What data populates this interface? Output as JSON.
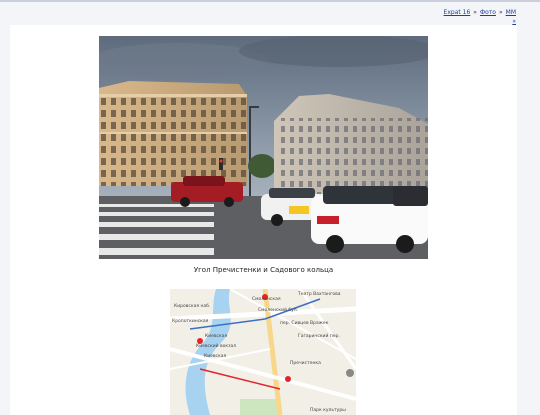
{
  "breadcrumb": {
    "items": [
      "Expat 16",
      "Фото",
      "ММ"
    ],
    "separator": "»",
    "trailing": "»"
  },
  "photo": {
    "caption": "Угол Пречистенки и Садового кольца"
  },
  "map": {
    "labels": [
      "Смоленская",
      "Театр Вахтангова",
      "Кропоткинская",
      "Смоленский бул.",
      "пер. Сивцев Вражек",
      "Гагаринский пер.",
      "Кировская наб.",
      "Киевская",
      "Киевский вокзал",
      "Киевская",
      "Пречистенка",
      "Парк культуры"
    ]
  },
  "colors": {
    "link": "#1f3f9a",
    "panel": "#ffffff",
    "background": "#f4f5f8",
    "water": "#a8d3f0",
    "metro": "#e4232b"
  }
}
